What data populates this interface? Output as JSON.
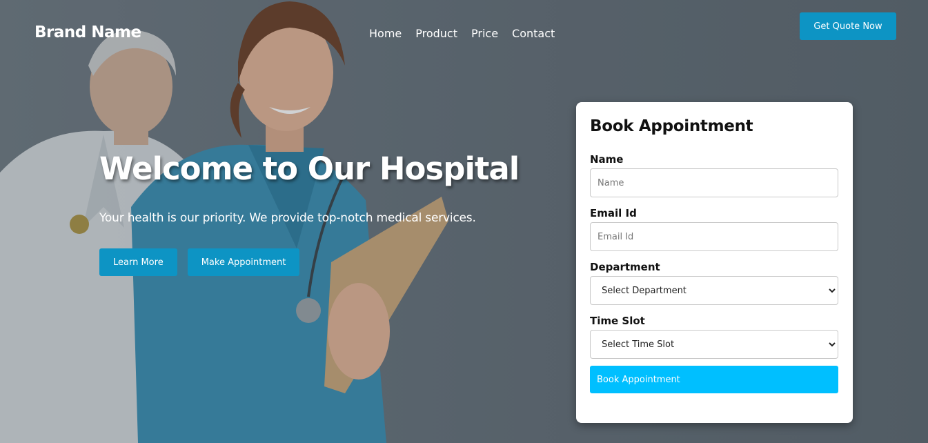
{
  "navbar": {
    "brand": "Brand Name",
    "links": [
      "Home",
      "Product",
      "Price",
      "Contact"
    ],
    "cta_label": "Get Quote Now"
  },
  "hero": {
    "title": "Welcome to Our Hospital",
    "subtitle": "Your health is our priority. We provide top-notch medical services.",
    "learn_more_label": "Learn More",
    "make_appointment_label": "Make Appointment"
  },
  "form": {
    "title": "Book Appointment",
    "name_label": "Name",
    "name_placeholder": "Name",
    "email_label": "Email Id",
    "email_placeholder": "Email Id",
    "department_label": "Department",
    "department_selected": "Select Department",
    "timeslot_label": "Time Slot",
    "timeslot_selected": "Select Time Slot",
    "submit_label": "Book Appointment"
  },
  "colors": {
    "accent": "#0d94c4",
    "submit": "#00bfff",
    "nurse_scrubs": "#3a8fb3",
    "doctor_coat": "#e8ecef"
  }
}
